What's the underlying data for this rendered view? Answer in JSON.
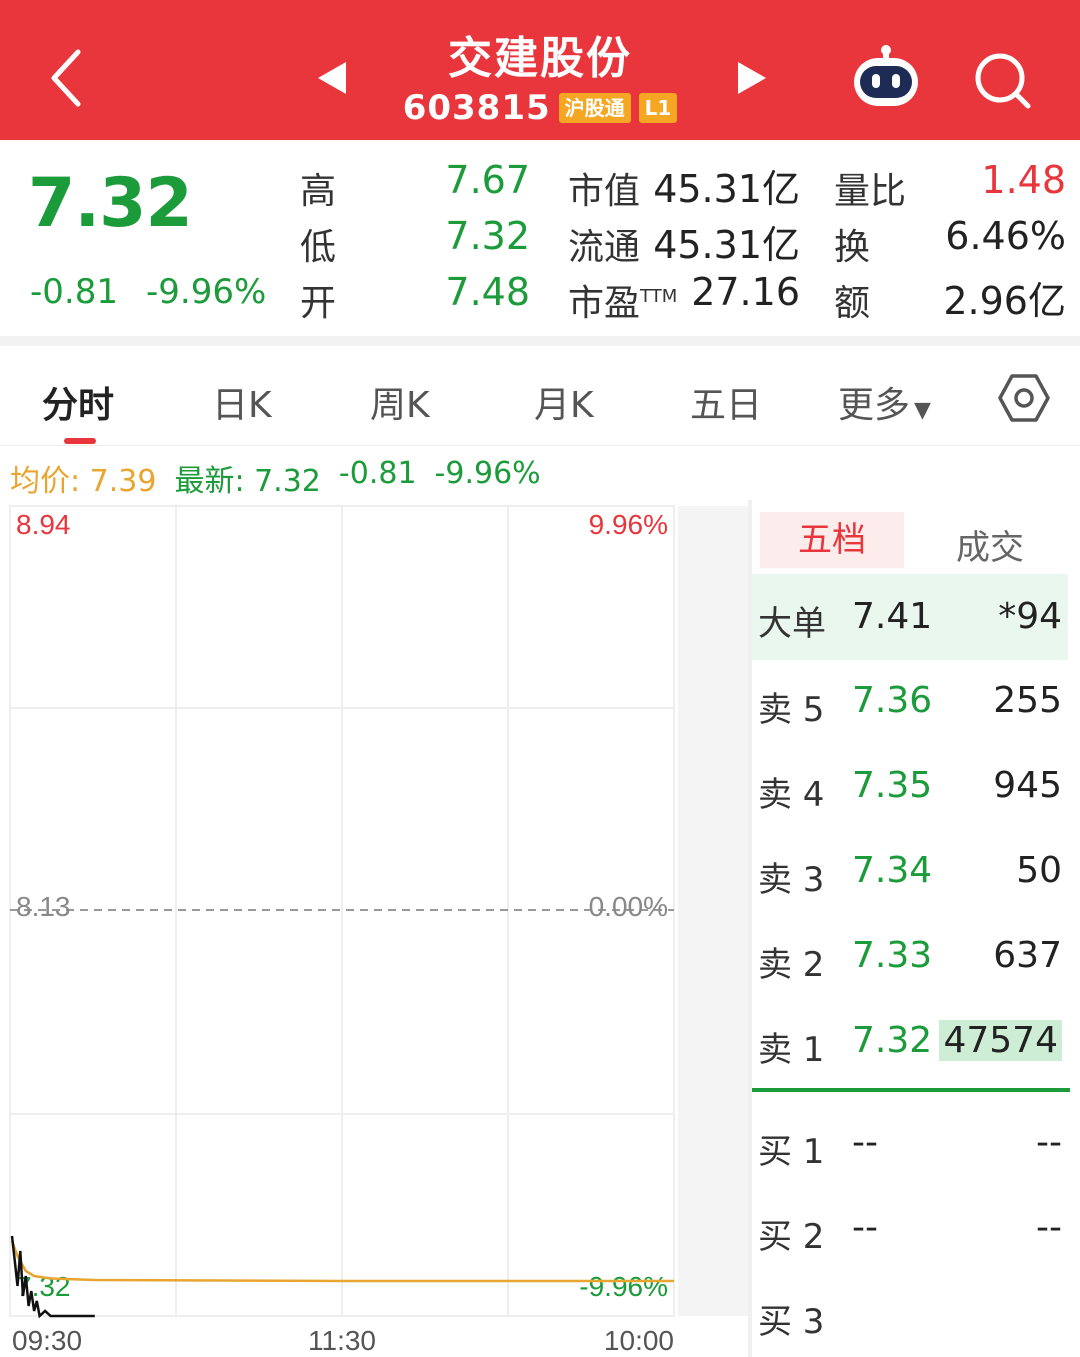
{
  "header": {
    "title": "交建股份",
    "code": "603815",
    "tag_market": "沪股通",
    "tag_level": "L1",
    "colors": {
      "bg": "#e8363c",
      "tag": "#f5a623"
    }
  },
  "quote": {
    "price": "7.32",
    "change": "-0.81",
    "change_pct": "-9.96%",
    "rows": [
      {
        "l1": "高",
        "v1": "7.67",
        "l2": "市值",
        "v2": "45.31亿",
        "l3": "量比",
        "v3": "1.48"
      },
      {
        "l1": "低",
        "v1": "7.32",
        "l2": "流通",
        "v2": "45.31亿",
        "l3": "换",
        "v3": "6.46%"
      },
      {
        "l1": "开",
        "v1": "7.48",
        "l2": "市盈",
        "l2_sup": "TTM",
        "v2": "27.16",
        "l3": "额",
        "v3": "2.96亿"
      }
    ]
  },
  "tabs": [
    {
      "label": "分时",
      "active": true
    },
    {
      "label": "日K"
    },
    {
      "label": "周K"
    },
    {
      "label": "月K"
    },
    {
      "label": "五日"
    },
    {
      "label": "更多"
    }
  ],
  "info_line": {
    "avg_label": "均价: 7.39",
    "latest_label": "最新: 7.32",
    "change": "-0.81",
    "change_pct": "-9.96%"
  },
  "chart_data": {
    "type": "line",
    "title": "",
    "y_top_label": "8.94",
    "y_mid_label": "8.13",
    "y_bottom_label": "7.32",
    "pct_top_label": "9.96%",
    "pct_mid_label": "0.00%",
    "pct_bottom_label": "-9.96%",
    "x_labels": [
      "09:30",
      "11:30",
      "10:00"
    ],
    "ylim": [
      7.32,
      8.94
    ],
    "series": [
      {
        "name": "price",
        "color": "#111111",
        "points": [
          [
            0,
            7.48
          ],
          [
            1,
            7.43
          ],
          [
            2,
            7.38
          ],
          [
            3,
            7.45
          ],
          [
            4,
            7.36
          ],
          [
            5,
            7.4
          ],
          [
            6,
            7.34
          ],
          [
            7,
            7.37
          ],
          [
            8,
            7.33
          ],
          [
            9,
            7.35
          ],
          [
            10,
            7.32
          ],
          [
            12,
            7.33
          ],
          [
            14,
            7.32
          ],
          [
            18,
            7.32
          ],
          [
            30,
            7.32
          ]
        ]
      },
      {
        "name": "avg",
        "color": "#e8a530",
        "points": [
          [
            0,
            7.47
          ],
          [
            2,
            7.44
          ],
          [
            5,
            7.41
          ],
          [
            8,
            7.4
          ],
          [
            14,
            7.395
          ],
          [
            30,
            7.392
          ],
          [
            120,
            7.39
          ],
          [
            240,
            7.39
          ]
        ]
      }
    ]
  },
  "order_book": {
    "tab_active": "五档",
    "tab_other": "成交",
    "big_order": {
      "label": "大单",
      "price": "7.41",
      "vol": "*94"
    },
    "asks": [
      {
        "label": "卖 5",
        "price": "7.36",
        "vol": "255"
      },
      {
        "label": "卖 4",
        "price": "7.35",
        "vol": "945"
      },
      {
        "label": "卖 3",
        "price": "7.34",
        "vol": "50"
      },
      {
        "label": "卖 2",
        "price": "7.33",
        "vol": "637"
      },
      {
        "label": "卖 1",
        "price": "7.32",
        "vol": "47574"
      }
    ],
    "bids": [
      {
        "label": "买 1",
        "price": "--",
        "vol": "--"
      },
      {
        "label": "买 2",
        "price": "--",
        "vol": "--"
      },
      {
        "label": "买 3",
        "price": "",
        "vol": ""
      }
    ]
  }
}
